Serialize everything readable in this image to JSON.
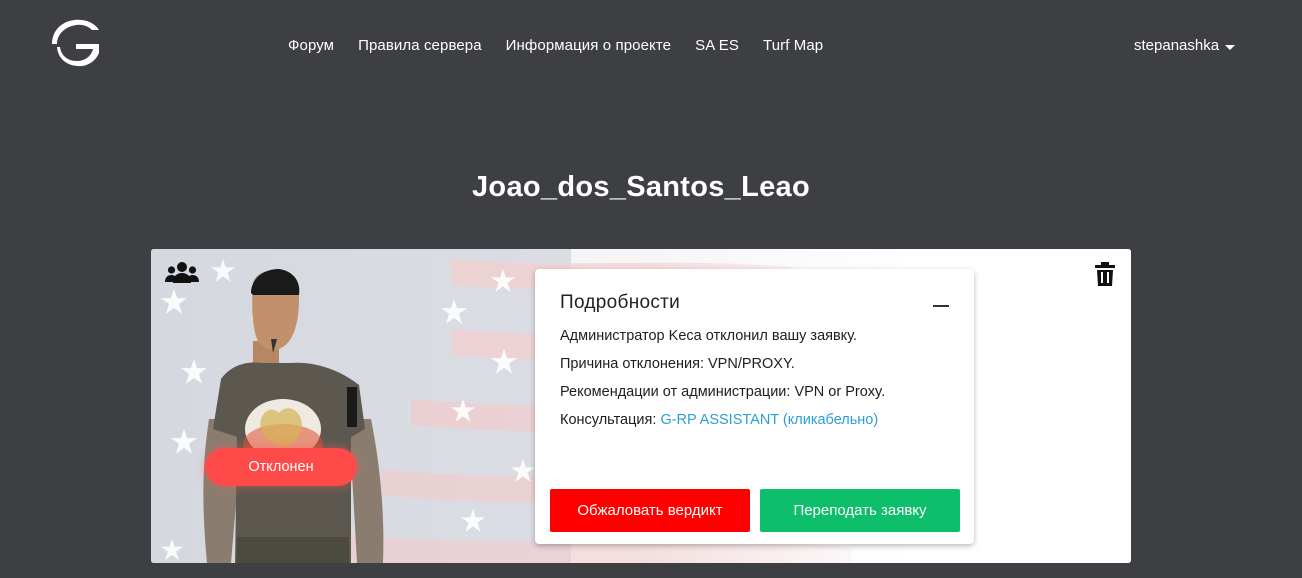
{
  "header": {
    "nav": [
      {
        "label": "Форум"
      },
      {
        "label": "Правила сервера"
      },
      {
        "label": "Информация о проекте"
      },
      {
        "label": "SA ES"
      },
      {
        "label": "Turf Map"
      }
    ],
    "user": {
      "name": "stepanashka"
    }
  },
  "page": {
    "title": "Joao_dos_Santos_Leao"
  },
  "card": {
    "status": "Отклонен",
    "details": {
      "title": "Подробности",
      "line1": "Администратор Keca отклонил вашу заявку.",
      "line2": "Причина отклонения: VPN/PROXY.",
      "line3": "Рекомендации от администрации: VPN or Proxy.",
      "line4_prefix": "Консультация: ",
      "line4_link": "G-RP ASSISTANT (кликабельно)"
    },
    "buttons": {
      "appeal": "Обжаловать вердикт",
      "resubmit": "Переподать заявку"
    }
  },
  "colors": {
    "background": "#3e3f42",
    "rejected": "#ff4a4a",
    "appeal": "#ff0000",
    "resubmit": "#0dbe6a",
    "link": "#2a9fd6"
  },
  "icons": [
    "logo-icon",
    "group-icon",
    "trash-icon",
    "chevron-down-icon",
    "collapse-icon"
  ]
}
